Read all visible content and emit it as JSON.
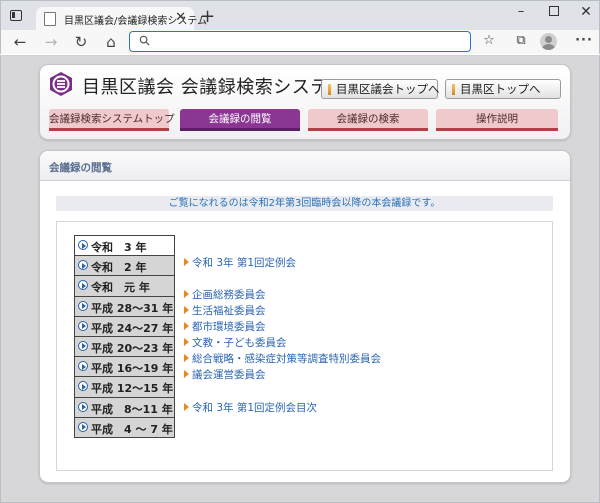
{
  "browser": {
    "tab_title": "目黒区議会/会議録検索システム",
    "tab_close": "✕",
    "new_tab": "+",
    "address_value": "",
    "win_minimize": "–",
    "win_close": "✕",
    "icons": [
      "back-icon",
      "forward-icon",
      "reload-icon",
      "home-icon",
      "search-icon",
      "favorites-icon",
      "collections-icon",
      "profile-icon",
      "more-icon"
    ]
  },
  "header": {
    "title": "目黒区議会 会議録検索システム",
    "link_council": "目黒区議会トップへ",
    "link_ward": "目黒区トップへ"
  },
  "nav": {
    "tabs": [
      {
        "label": "会議録検索システムトップ",
        "active": false
      },
      {
        "label": "会議録の閲覧",
        "active": true
      },
      {
        "label": "会議録の検索",
        "active": false
      },
      {
        "label": "操作説明",
        "active": false
      }
    ]
  },
  "main": {
    "section_title": "会議録の閲覧",
    "notice": "ご覧になれるのは令和2年第3回臨時会以降の本会議録です。",
    "years": [
      {
        "label": "令和　3 年",
        "selected": true
      },
      {
        "label": "令和　2 年",
        "selected": false
      },
      {
        "label": "令和　元 年",
        "selected": false
      },
      {
        "label": "平成 28～31 年",
        "selected": false
      },
      {
        "label": "平成 24～27 年",
        "selected": false
      },
      {
        "label": "平成 20～23 年",
        "selected": false
      },
      {
        "label": "平成 16～19 年",
        "selected": false
      },
      {
        "label": "平成 12～15 年",
        "selected": false
      },
      {
        "label": "平成　8～11 年",
        "selected": false
      },
      {
        "label": "平成　4 ～ 7 年",
        "selected": false
      }
    ],
    "meetings": [
      "令和 3年 第1回定例会",
      "企画総務委員会",
      "生活福祉委員会",
      "都市環境委員会",
      "文教・子ども委員会",
      "総合戦略・感染症対策等調査特別委員会",
      "議会運営委員会",
      "令和 3年 第1回定例会目次"
    ]
  },
  "colors": {
    "accent_purple": "#8c3694",
    "tab_pink": "#f0c9cc",
    "link_blue": "#2a64b3",
    "notice_blue": "#2a72b7",
    "arrow_orange": "#e88b16"
  }
}
